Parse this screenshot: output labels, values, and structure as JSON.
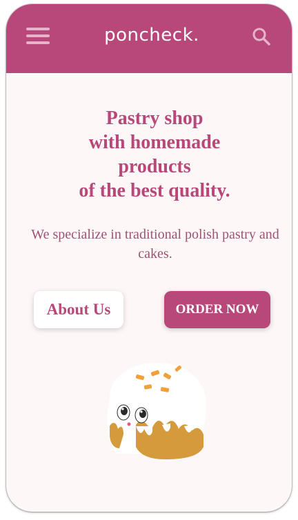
{
  "header": {
    "brand": "poncheck.",
    "menu_icon": "hamburger-menu-icon",
    "search_icon": "search-icon"
  },
  "hero": {
    "title_lines": [
      "Pastry shop",
      "with homemade",
      "products",
      "of the best quality."
    ],
    "description": "We specialize in traditional polish pastry and cakes."
  },
  "buttons": {
    "about_label": "About Us",
    "order_label": "ORDER NOW"
  },
  "illustration": {
    "icon": "donut-mascot-illustration"
  },
  "colors": {
    "accent": "#b9487a",
    "header_icons": "#e6b3c9",
    "background": "#fdf7f8",
    "text_muted": "#9b5374"
  }
}
